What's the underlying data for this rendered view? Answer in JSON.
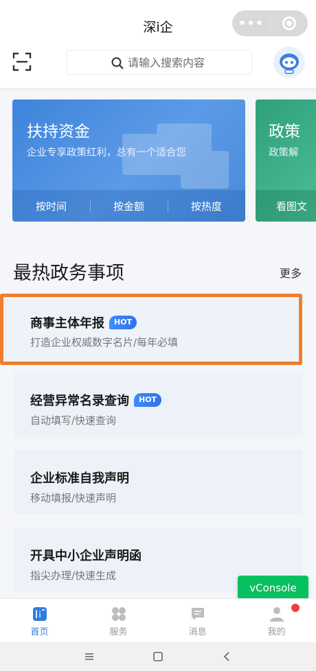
{
  "header": {
    "title": "深i企",
    "capsule_dots": "•••",
    "search_placeholder": "请输入搜索内容"
  },
  "banners": [
    {
      "title": "扶持资金",
      "subtitle": "企业专享政策红利，总有一个适合您",
      "options": [
        "按时间",
        "按金额",
        "按热度"
      ]
    },
    {
      "title": "政策",
      "subtitle": "政策解",
      "options": [
        "看图文"
      ]
    }
  ],
  "section": {
    "title": "最热政务事项",
    "more": "更多"
  },
  "items": [
    {
      "title": "商事主体年报",
      "badge": "HOT",
      "subtitle": "打造企业权威数字名片/每年必填"
    },
    {
      "title": "经营异常名录查询",
      "badge": "HOT",
      "subtitle": "自动填写/快速查询"
    },
    {
      "title": "企业标准自我声明",
      "badge": "",
      "subtitle": "移动填报/快速声明"
    },
    {
      "title": "开具中小企业声明函",
      "badge": "",
      "subtitle": "指尖办理/快速生成"
    }
  ],
  "vconsole_label": "vConsole",
  "tabbar": [
    {
      "label": "首页",
      "icon": "home-icon",
      "active": true
    },
    {
      "label": "服务",
      "icon": "grid-icon",
      "active": false
    },
    {
      "label": "消息",
      "icon": "message-icon",
      "active": false
    },
    {
      "label": "我的",
      "icon": "person-icon",
      "active": false
    }
  ],
  "colors": {
    "accent": "#2f7be0",
    "highlight_border": "#f27d2f",
    "banner_blue": "#4a8ad9",
    "vconsole_green": "#07c160",
    "badge_red": "#f23d3d"
  }
}
